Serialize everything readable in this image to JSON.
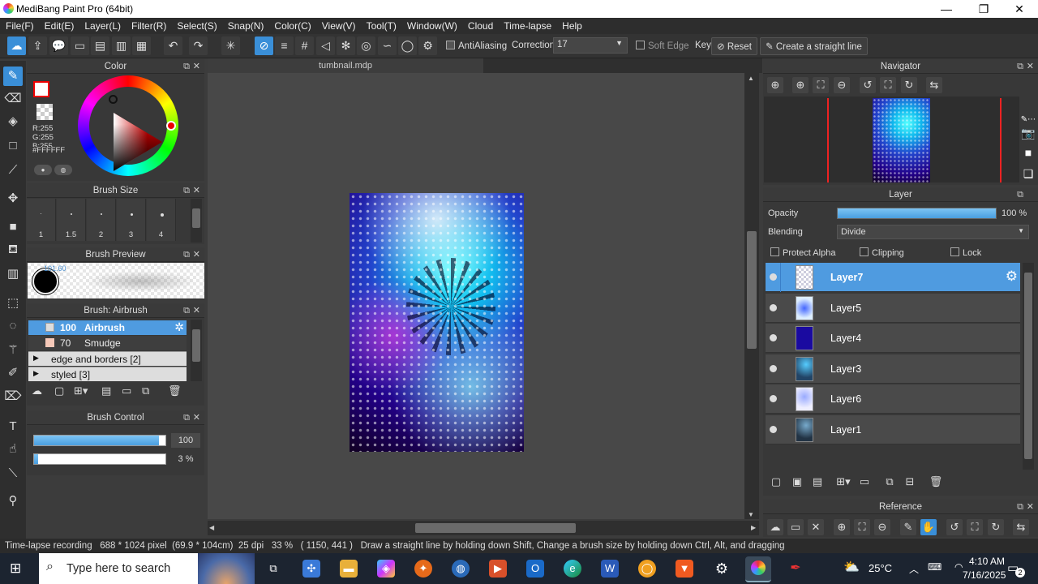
{
  "window": {
    "title": "MediBang Paint Pro (64bit)",
    "min": "—",
    "max": "❐",
    "close": "✕"
  },
  "menu": [
    "File(F)",
    "Edit(E)",
    "Layer(L)",
    "Filter(R)",
    "Select(S)",
    "Snap(N)",
    "Color(C)",
    "View(V)",
    "Tool(T)",
    "Window(W)",
    "Cloud",
    "Time-lapse",
    "Help"
  ],
  "toolbar": {
    "antialiasing": "AntiAliasing",
    "correction_label": "Correction",
    "correction_value": "17",
    "soft_edge": "Soft Edge",
    "key": "Key",
    "reset": "Reset",
    "straight_line": "Create a straight line"
  },
  "color_panel": {
    "title": "Color",
    "r": "R:255",
    "g": "G:255",
    "b": "B:255",
    "hex": "#FFFFFF",
    "fg": "#ffffff"
  },
  "brush_size": {
    "title": "Brush Size",
    "sizes": [
      "1",
      "1.5",
      "2",
      "3",
      "4"
    ]
  },
  "brush_preview": {
    "title": "Brush Preview",
    "size_label": "101.60"
  },
  "brush_list": {
    "title": "Brush: Airbrush",
    "items": [
      {
        "size": "100",
        "name": "Airbrush"
      },
      {
        "size": "70",
        "name": "Smudge"
      }
    ],
    "groups": [
      "edge and borders [2]",
      "styled [3]"
    ]
  },
  "brush_control": {
    "title": "Brush Control",
    "size_value": "100",
    "opacity_value": "3 %",
    "size_fraction": 0.95,
    "opacity_fraction": 0.03
  },
  "document": {
    "tab": "tumbnail.mdp"
  },
  "navigator": {
    "title": "Navigator"
  },
  "layer_panel": {
    "title": "Layer",
    "opacity_label": "Opacity",
    "opacity_value": "100 %",
    "blending_label": "Blending",
    "blending_value": "Divide",
    "protect_alpha": "Protect Alpha",
    "clipping": "Clipping",
    "lock": "Lock",
    "layers": [
      "Layer7",
      "Layer5",
      "Layer4",
      "Layer3",
      "Layer6",
      "Layer1"
    ]
  },
  "reference": {
    "title": "Reference"
  },
  "status": {
    "recording": "Time-lapse recording",
    "size": "688 * 1024 pixel",
    "cm": "(69.9 * 104cm)",
    "dpi": "25 dpi",
    "zoom": "33 %",
    "coords": "( 1150, 441 )",
    "hint": "Draw a straight line by holding down Shift, Change a brush size by holding down Ctrl, Alt, and dragging"
  },
  "taskbar": {
    "search_placeholder": "Type here to search",
    "temp": "25°C",
    "time": "4:10 AM",
    "date": "7/16/2025",
    "notif_count": "2"
  },
  "colors": {
    "accent": "#3a8fd8",
    "selected_row": "#4f9be0",
    "panel": "#383838"
  }
}
